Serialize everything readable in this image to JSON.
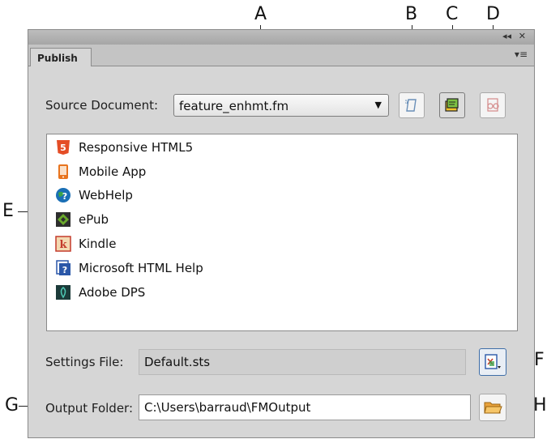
{
  "callouts": {
    "a": "A",
    "b": "B",
    "c": "C",
    "d": "D",
    "e": "E",
    "f": "F",
    "g": "G",
    "h": "H"
  },
  "window": {
    "tab_label": "Publish",
    "collapse_icon": "collapse-panel-icon",
    "close_icon": "close-icon",
    "panel_menu_icon": "panel-menu-icon"
  },
  "source": {
    "label": "Source Document:",
    "selected": "feature_enhmt.fm",
    "dropdown_icon": "chevron-down-icon"
  },
  "toolbar": {
    "b_icon": "document-icon",
    "c_icon": "publish-all-icon",
    "d_icon": "view-output-icon"
  },
  "outputs": [
    {
      "label": "Responsive HTML5",
      "icon": "html5-icon",
      "color": "#e44d26"
    },
    {
      "label": "Mobile App",
      "icon": "mobile-app-icon",
      "color": "#e8741e"
    },
    {
      "label": "WebHelp",
      "icon": "webhelp-icon",
      "color": "#1a6fb5"
    },
    {
      "label": "ePub",
      "icon": "epub-icon",
      "color": "#6aa92c"
    },
    {
      "label": "Kindle",
      "icon": "kindle-icon",
      "color": "#c43b2c"
    },
    {
      "label": "Microsoft HTML Help",
      "icon": "html-help-icon",
      "color": "#2a57a8"
    },
    {
      "label": "Adobe DPS",
      "icon": "adobe-dps-icon",
      "color": "#1c3b3a"
    }
  ],
  "settings": {
    "label": "Settings File:",
    "value": "Default.sts",
    "button_icon": "settings-file-icon"
  },
  "output_folder": {
    "label": "Output Folder:",
    "value": "C:\\Users\\barraud\\FMOutput",
    "button_icon": "folder-icon"
  }
}
